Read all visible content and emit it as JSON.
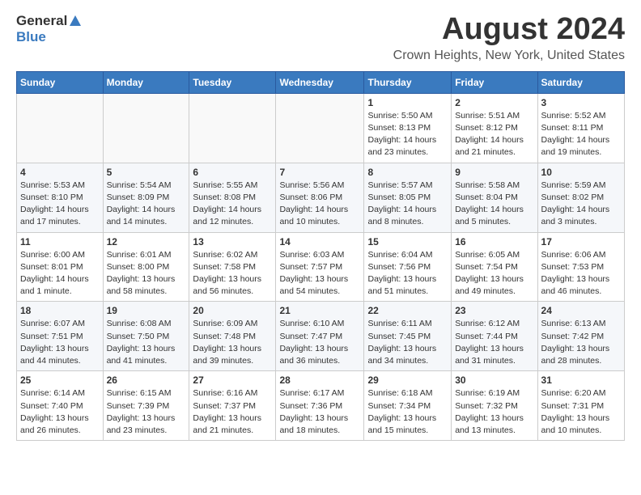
{
  "header": {
    "logo_general": "General",
    "logo_blue": "Blue",
    "title": "August 2024",
    "subtitle": "Crown Heights, New York, United States"
  },
  "calendar": {
    "days_of_week": [
      "Sunday",
      "Monday",
      "Tuesday",
      "Wednesday",
      "Thursday",
      "Friday",
      "Saturday"
    ],
    "weeks": [
      [
        {
          "day": "",
          "content": ""
        },
        {
          "day": "",
          "content": ""
        },
        {
          "day": "",
          "content": ""
        },
        {
          "day": "",
          "content": ""
        },
        {
          "day": "1",
          "content": "Sunrise: 5:50 AM\nSunset: 8:13 PM\nDaylight: 14 hours\nand 23 minutes."
        },
        {
          "day": "2",
          "content": "Sunrise: 5:51 AM\nSunset: 8:12 PM\nDaylight: 14 hours\nand 21 minutes."
        },
        {
          "day": "3",
          "content": "Sunrise: 5:52 AM\nSunset: 8:11 PM\nDaylight: 14 hours\nand 19 minutes."
        }
      ],
      [
        {
          "day": "4",
          "content": "Sunrise: 5:53 AM\nSunset: 8:10 PM\nDaylight: 14 hours\nand 17 minutes."
        },
        {
          "day": "5",
          "content": "Sunrise: 5:54 AM\nSunset: 8:09 PM\nDaylight: 14 hours\nand 14 minutes."
        },
        {
          "day": "6",
          "content": "Sunrise: 5:55 AM\nSunset: 8:08 PM\nDaylight: 14 hours\nand 12 minutes."
        },
        {
          "day": "7",
          "content": "Sunrise: 5:56 AM\nSunset: 8:06 PM\nDaylight: 14 hours\nand 10 minutes."
        },
        {
          "day": "8",
          "content": "Sunrise: 5:57 AM\nSunset: 8:05 PM\nDaylight: 14 hours\nand 8 minutes."
        },
        {
          "day": "9",
          "content": "Sunrise: 5:58 AM\nSunset: 8:04 PM\nDaylight: 14 hours\nand 5 minutes."
        },
        {
          "day": "10",
          "content": "Sunrise: 5:59 AM\nSunset: 8:02 PM\nDaylight: 14 hours\nand 3 minutes."
        }
      ],
      [
        {
          "day": "11",
          "content": "Sunrise: 6:00 AM\nSunset: 8:01 PM\nDaylight: 14 hours\nand 1 minute."
        },
        {
          "day": "12",
          "content": "Sunrise: 6:01 AM\nSunset: 8:00 PM\nDaylight: 13 hours\nand 58 minutes."
        },
        {
          "day": "13",
          "content": "Sunrise: 6:02 AM\nSunset: 7:58 PM\nDaylight: 13 hours\nand 56 minutes."
        },
        {
          "day": "14",
          "content": "Sunrise: 6:03 AM\nSunset: 7:57 PM\nDaylight: 13 hours\nand 54 minutes."
        },
        {
          "day": "15",
          "content": "Sunrise: 6:04 AM\nSunset: 7:56 PM\nDaylight: 13 hours\nand 51 minutes."
        },
        {
          "day": "16",
          "content": "Sunrise: 6:05 AM\nSunset: 7:54 PM\nDaylight: 13 hours\nand 49 minutes."
        },
        {
          "day": "17",
          "content": "Sunrise: 6:06 AM\nSunset: 7:53 PM\nDaylight: 13 hours\nand 46 minutes."
        }
      ],
      [
        {
          "day": "18",
          "content": "Sunrise: 6:07 AM\nSunset: 7:51 PM\nDaylight: 13 hours\nand 44 minutes."
        },
        {
          "day": "19",
          "content": "Sunrise: 6:08 AM\nSunset: 7:50 PM\nDaylight: 13 hours\nand 41 minutes."
        },
        {
          "day": "20",
          "content": "Sunrise: 6:09 AM\nSunset: 7:48 PM\nDaylight: 13 hours\nand 39 minutes."
        },
        {
          "day": "21",
          "content": "Sunrise: 6:10 AM\nSunset: 7:47 PM\nDaylight: 13 hours\nand 36 minutes."
        },
        {
          "day": "22",
          "content": "Sunrise: 6:11 AM\nSunset: 7:45 PM\nDaylight: 13 hours\nand 34 minutes."
        },
        {
          "day": "23",
          "content": "Sunrise: 6:12 AM\nSunset: 7:44 PM\nDaylight: 13 hours\nand 31 minutes."
        },
        {
          "day": "24",
          "content": "Sunrise: 6:13 AM\nSunset: 7:42 PM\nDaylight: 13 hours\nand 28 minutes."
        }
      ],
      [
        {
          "day": "25",
          "content": "Sunrise: 6:14 AM\nSunset: 7:40 PM\nDaylight: 13 hours\nand 26 minutes."
        },
        {
          "day": "26",
          "content": "Sunrise: 6:15 AM\nSunset: 7:39 PM\nDaylight: 13 hours\nand 23 minutes."
        },
        {
          "day": "27",
          "content": "Sunrise: 6:16 AM\nSunset: 7:37 PM\nDaylight: 13 hours\nand 21 minutes."
        },
        {
          "day": "28",
          "content": "Sunrise: 6:17 AM\nSunset: 7:36 PM\nDaylight: 13 hours\nand 18 minutes."
        },
        {
          "day": "29",
          "content": "Sunrise: 6:18 AM\nSunset: 7:34 PM\nDaylight: 13 hours\nand 15 minutes."
        },
        {
          "day": "30",
          "content": "Sunrise: 6:19 AM\nSunset: 7:32 PM\nDaylight: 13 hours\nand 13 minutes."
        },
        {
          "day": "31",
          "content": "Sunrise: 6:20 AM\nSunset: 7:31 PM\nDaylight: 13 hours\nand 10 minutes."
        }
      ]
    ]
  }
}
